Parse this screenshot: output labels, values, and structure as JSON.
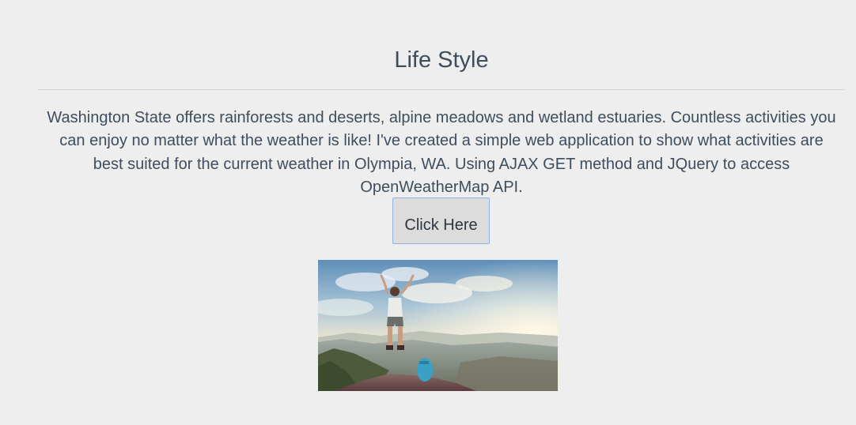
{
  "page": {
    "title": "Life Style",
    "intro": "Washington State offers rainforests and deserts, alpine meadows and wetland estuaries. Countless activities you can enjoy no matter what the weather is like! I've created a simple web application to show what activities are best suited for the current weather in Olympia, WA. Using AJAX GET method and JQuery to access OpenWeatherMap API.",
    "button_label": "Click Here"
  },
  "hero_image": {
    "subject": "hiker-on-mountain-peak",
    "colors": {
      "sky_top": "#5f8fb9",
      "sky_haze": "#f3ead0",
      "ground": "#6a4a46"
    }
  },
  "theme": {
    "background": "#eeeeee",
    "text": "#3f4d5c",
    "button_background": "#dcdcdc",
    "button_border": "#8fb2e8"
  }
}
